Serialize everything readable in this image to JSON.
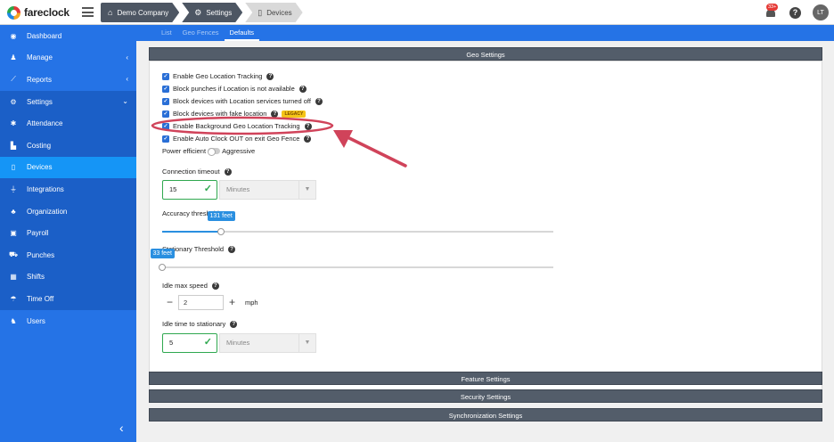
{
  "brand": {
    "name": "fareclock"
  },
  "breadcrumb": [
    {
      "label": "Demo Company",
      "icon": "home-icon"
    },
    {
      "label": "Settings",
      "icon": "gear-icon"
    },
    {
      "label": "Devices",
      "icon": "device-icon"
    }
  ],
  "topbar": {
    "notification_count": "33+",
    "help": "?",
    "avatar_initials": "LT"
  },
  "sidebar": {
    "items": [
      {
        "label": "Dashboard",
        "icon": "dashboard-icon"
      },
      {
        "label": "Manage",
        "icon": "person-icon"
      },
      {
        "label": "Reports",
        "icon": "chart-icon"
      },
      {
        "label": "Settings",
        "icon": "gear-icon"
      },
      {
        "label": "Attendance",
        "icon": "attendance-icon"
      },
      {
        "label": "Costing",
        "icon": "costing-icon"
      },
      {
        "label": "Devices",
        "icon": "device-icon"
      },
      {
        "label": "Integrations",
        "icon": "plug-icon"
      },
      {
        "label": "Organization",
        "icon": "org-icon"
      },
      {
        "label": "Payroll",
        "icon": "payroll-icon"
      },
      {
        "label": "Punches",
        "icon": "punch-icon"
      },
      {
        "label": "Shifts",
        "icon": "shifts-icon"
      },
      {
        "label": "Time Off",
        "icon": "timeoff-icon"
      },
      {
        "label": "Users",
        "icon": "users-icon"
      }
    ]
  },
  "tabs": [
    "List",
    "Geo Fences",
    "Defaults"
  ],
  "geo": {
    "header": "Geo Settings",
    "checkboxes": [
      "Enable Geo Location Tracking",
      "Block punches if Location is not available",
      "Block devices with Location services turned off",
      "Block devices with fake location",
      "Enable Background Geo Location Tracking",
      "Enable Auto Clock OUT on exit Geo Fence"
    ],
    "legacy_badge": "LEGACY",
    "power_efficient": "Power efficient",
    "aggressive": "Aggressive",
    "connection_timeout": {
      "label": "Connection timeout",
      "value": "15",
      "unit": "Minutes"
    },
    "accuracy": {
      "label": "Accuracy threshold",
      "value_label": "131 feet",
      "fraction": 0.15
    },
    "stationary": {
      "label": "Stationary Threshold",
      "value_label": "33 feet",
      "fraction": 0.0
    },
    "idle_speed": {
      "label": "Idle max speed",
      "value": "2",
      "unit": "mph"
    },
    "idle_time": {
      "label": "Idle time to stationary",
      "value": "5",
      "unit": "Minutes"
    }
  },
  "sections": [
    "Feature Settings",
    "Security Settings",
    "Synchronization Settings"
  ],
  "colors": {
    "sidebar": "#2573e6",
    "selected": "#1595f6",
    "section_header": "#535d6a",
    "annotation": "#d0435a"
  }
}
